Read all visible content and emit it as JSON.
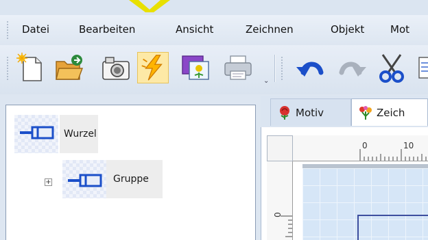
{
  "menu": {
    "items": [
      "Datei",
      "Bearbeiten",
      "Ansicht",
      "Zeichnen",
      "Objekt",
      "Mot"
    ]
  },
  "toolbar": {
    "buttons": [
      {
        "icon": "new-file-icon"
      },
      {
        "icon": "open-folder-icon"
      },
      {
        "icon": "camera-icon"
      },
      {
        "icon": "lightning-icon",
        "active": true
      },
      {
        "icon": "image-import-icon"
      },
      {
        "icon": "printer-icon"
      },
      {
        "icon": "undo-icon"
      },
      {
        "icon": "redo-icon"
      },
      {
        "icon": "cut-icon"
      }
    ],
    "overflow": "⌄"
  },
  "tree": {
    "nodes": [
      {
        "label": "Wurzel",
        "expander": ""
      },
      {
        "label": "Gruppe",
        "expander": "+"
      }
    ]
  },
  "tabs": [
    {
      "label": "Motiv",
      "icon": "rose-icon",
      "active": false
    },
    {
      "label": "Zeich",
      "icon": "flower-icon",
      "active": true
    }
  ],
  "ruler": {
    "top_labels": [
      "0",
      "10"
    ],
    "left_labels": [
      "0"
    ]
  },
  "colors": {
    "menu_bg": "#dde6f1",
    "active_button": "#fde9a6",
    "canvas": "#d6e6f7",
    "icon_blue": "#1b4fc9",
    "object_outline": "#3d4e9e"
  }
}
